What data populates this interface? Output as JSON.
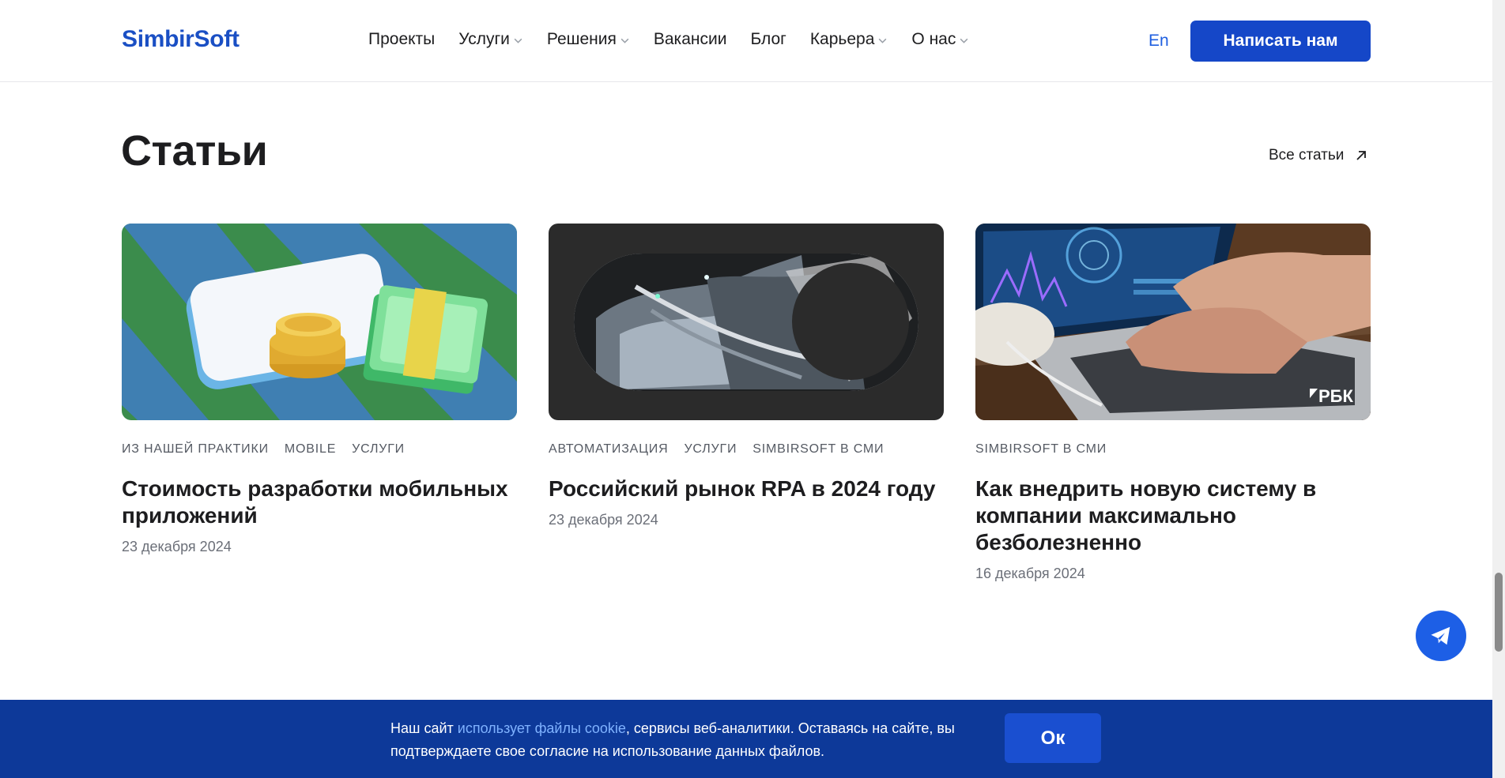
{
  "header": {
    "logo": "SimbirSoft",
    "nav": [
      {
        "label": "Проекты",
        "dropdown": false
      },
      {
        "label": "Услуги",
        "dropdown": true
      },
      {
        "label": "Решения",
        "dropdown": true
      },
      {
        "label": "Вакансии",
        "dropdown": false
      },
      {
        "label": "Блог",
        "dropdown": false
      },
      {
        "label": "Карьера",
        "dropdown": true
      },
      {
        "label": "О нас",
        "dropdown": true
      }
    ],
    "lang": "En",
    "cta": "Написать нам"
  },
  "section": {
    "title": "Статьи",
    "all_link": "Все статьи"
  },
  "cards": [
    {
      "tags": [
        "ИЗ НАШЕЙ ПРАКТИКИ",
        "MOBILE",
        "УСЛУГИ"
      ],
      "title": "Стоимость разработки мобильных приложений",
      "date": "23 декабря 2024"
    },
    {
      "tags": [
        "АВТОМАТИЗАЦИЯ",
        "УСЛУГИ",
        "SIMBIRSOFT В СМИ"
      ],
      "title": "Российский рынок RPA в 2024 году",
      "date": "23 декабря 2024"
    },
    {
      "tags": [
        "SIMBIRSOFT В СМИ"
      ],
      "title": "Как внедрить новую систему в компании максимально безболезненно",
      "date": "16 декабря 2024",
      "image_badge": "РБК"
    }
  ],
  "cookie": {
    "text_before": "Наш сайт ",
    "link": "использует файлы cookie",
    "text_after": ", сервисы веб-аналитики. Оставаясь на сайте, вы подтверждаете свое согласие на использование данных файлов.",
    "button": "Ок"
  },
  "colors": {
    "brand": "#1a4fc4",
    "cta": "#1547c8",
    "cookie_bg": "#0d3999",
    "link": "#7fb2ff"
  },
  "icons": [
    "chevron-down-icon",
    "arrow-up-right-icon",
    "telegram-icon"
  ]
}
